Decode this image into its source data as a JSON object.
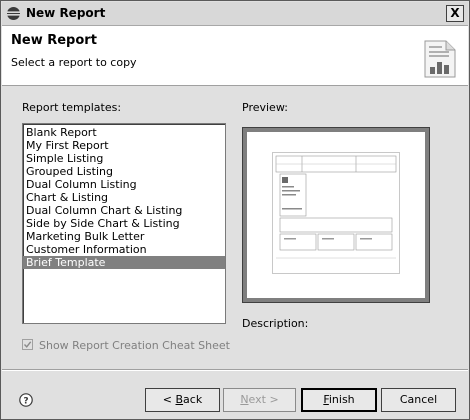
{
  "window": {
    "title": "New Report",
    "close_glyph": "X"
  },
  "header": {
    "title": "New Report",
    "description": "Select a report to copy",
    "icon": "report-chart-icon"
  },
  "templates": {
    "label": "Report templates:",
    "items": [
      {
        "label": "Blank Report"
      },
      {
        "label": "My First Report"
      },
      {
        "label": "Simple Listing"
      },
      {
        "label": "Grouped Listing"
      },
      {
        "label": "Dual Column Listing"
      },
      {
        "label": "Chart & Listing"
      },
      {
        "label": "Dual Column Chart & Listing"
      },
      {
        "label": "Side by Side Chart & Listing"
      },
      {
        "label": "Marketing Bulk Letter"
      },
      {
        "label": "Customer Information"
      },
      {
        "label": "Brief Template",
        "selected": true
      }
    ]
  },
  "preview": {
    "label": "Preview:"
  },
  "description": {
    "label": "Description:"
  },
  "cheat_sheet": {
    "label": "Show Report Creation Cheat Sheet",
    "checked": true,
    "enabled": false
  },
  "buttons": {
    "back": {
      "mnemonic": "B",
      "rest": "ack",
      "prefix": "< "
    },
    "next": {
      "mnemonic": "N",
      "rest": "ext",
      "suffix": " >"
    },
    "finish": {
      "mnemonic": "F",
      "rest": "inish"
    },
    "cancel": {
      "label": "Cancel"
    }
  },
  "help": {
    "icon": "help-icon"
  }
}
